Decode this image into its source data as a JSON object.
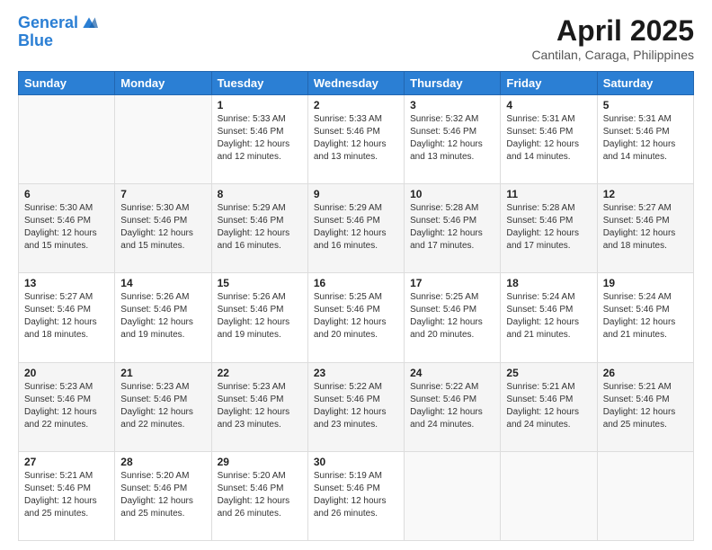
{
  "header": {
    "logo_line1": "General",
    "logo_line2": "Blue",
    "title": "April 2025",
    "subtitle": "Cantilan, Caraga, Philippines"
  },
  "days_of_week": [
    "Sunday",
    "Monday",
    "Tuesday",
    "Wednesday",
    "Thursday",
    "Friday",
    "Saturday"
  ],
  "weeks": [
    [
      {
        "day": "",
        "sunrise": "",
        "sunset": "",
        "daylight": ""
      },
      {
        "day": "",
        "sunrise": "",
        "sunset": "",
        "daylight": ""
      },
      {
        "day": "1",
        "sunrise": "Sunrise: 5:33 AM",
        "sunset": "Sunset: 5:46 PM",
        "daylight": "Daylight: 12 hours and 12 minutes."
      },
      {
        "day": "2",
        "sunrise": "Sunrise: 5:33 AM",
        "sunset": "Sunset: 5:46 PM",
        "daylight": "Daylight: 12 hours and 13 minutes."
      },
      {
        "day": "3",
        "sunrise": "Sunrise: 5:32 AM",
        "sunset": "Sunset: 5:46 PM",
        "daylight": "Daylight: 12 hours and 13 minutes."
      },
      {
        "day": "4",
        "sunrise": "Sunrise: 5:31 AM",
        "sunset": "Sunset: 5:46 PM",
        "daylight": "Daylight: 12 hours and 14 minutes."
      },
      {
        "day": "5",
        "sunrise": "Sunrise: 5:31 AM",
        "sunset": "Sunset: 5:46 PM",
        "daylight": "Daylight: 12 hours and 14 minutes."
      }
    ],
    [
      {
        "day": "6",
        "sunrise": "Sunrise: 5:30 AM",
        "sunset": "Sunset: 5:46 PM",
        "daylight": "Daylight: 12 hours and 15 minutes."
      },
      {
        "day": "7",
        "sunrise": "Sunrise: 5:30 AM",
        "sunset": "Sunset: 5:46 PM",
        "daylight": "Daylight: 12 hours and 15 minutes."
      },
      {
        "day": "8",
        "sunrise": "Sunrise: 5:29 AM",
        "sunset": "Sunset: 5:46 PM",
        "daylight": "Daylight: 12 hours and 16 minutes."
      },
      {
        "day": "9",
        "sunrise": "Sunrise: 5:29 AM",
        "sunset": "Sunset: 5:46 PM",
        "daylight": "Daylight: 12 hours and 16 minutes."
      },
      {
        "day": "10",
        "sunrise": "Sunrise: 5:28 AM",
        "sunset": "Sunset: 5:46 PM",
        "daylight": "Daylight: 12 hours and 17 minutes."
      },
      {
        "day": "11",
        "sunrise": "Sunrise: 5:28 AM",
        "sunset": "Sunset: 5:46 PM",
        "daylight": "Daylight: 12 hours and 17 minutes."
      },
      {
        "day": "12",
        "sunrise": "Sunrise: 5:27 AM",
        "sunset": "Sunset: 5:46 PM",
        "daylight": "Daylight: 12 hours and 18 minutes."
      }
    ],
    [
      {
        "day": "13",
        "sunrise": "Sunrise: 5:27 AM",
        "sunset": "Sunset: 5:46 PM",
        "daylight": "Daylight: 12 hours and 18 minutes."
      },
      {
        "day": "14",
        "sunrise": "Sunrise: 5:26 AM",
        "sunset": "Sunset: 5:46 PM",
        "daylight": "Daylight: 12 hours and 19 minutes."
      },
      {
        "day": "15",
        "sunrise": "Sunrise: 5:26 AM",
        "sunset": "Sunset: 5:46 PM",
        "daylight": "Daylight: 12 hours and 19 minutes."
      },
      {
        "day": "16",
        "sunrise": "Sunrise: 5:25 AM",
        "sunset": "Sunset: 5:46 PM",
        "daylight": "Daylight: 12 hours and 20 minutes."
      },
      {
        "day": "17",
        "sunrise": "Sunrise: 5:25 AM",
        "sunset": "Sunset: 5:46 PM",
        "daylight": "Daylight: 12 hours and 20 minutes."
      },
      {
        "day": "18",
        "sunrise": "Sunrise: 5:24 AM",
        "sunset": "Sunset: 5:46 PM",
        "daylight": "Daylight: 12 hours and 21 minutes."
      },
      {
        "day": "19",
        "sunrise": "Sunrise: 5:24 AM",
        "sunset": "Sunset: 5:46 PM",
        "daylight": "Daylight: 12 hours and 21 minutes."
      }
    ],
    [
      {
        "day": "20",
        "sunrise": "Sunrise: 5:23 AM",
        "sunset": "Sunset: 5:46 PM",
        "daylight": "Daylight: 12 hours and 22 minutes."
      },
      {
        "day": "21",
        "sunrise": "Sunrise: 5:23 AM",
        "sunset": "Sunset: 5:46 PM",
        "daylight": "Daylight: 12 hours and 22 minutes."
      },
      {
        "day": "22",
        "sunrise": "Sunrise: 5:23 AM",
        "sunset": "Sunset: 5:46 PM",
        "daylight": "Daylight: 12 hours and 23 minutes."
      },
      {
        "day": "23",
        "sunrise": "Sunrise: 5:22 AM",
        "sunset": "Sunset: 5:46 PM",
        "daylight": "Daylight: 12 hours and 23 minutes."
      },
      {
        "day": "24",
        "sunrise": "Sunrise: 5:22 AM",
        "sunset": "Sunset: 5:46 PM",
        "daylight": "Daylight: 12 hours and 24 minutes."
      },
      {
        "day": "25",
        "sunrise": "Sunrise: 5:21 AM",
        "sunset": "Sunset: 5:46 PM",
        "daylight": "Daylight: 12 hours and 24 minutes."
      },
      {
        "day": "26",
        "sunrise": "Sunrise: 5:21 AM",
        "sunset": "Sunset: 5:46 PM",
        "daylight": "Daylight: 12 hours and 25 minutes."
      }
    ],
    [
      {
        "day": "27",
        "sunrise": "Sunrise: 5:21 AM",
        "sunset": "Sunset: 5:46 PM",
        "daylight": "Daylight: 12 hours and 25 minutes."
      },
      {
        "day": "28",
        "sunrise": "Sunrise: 5:20 AM",
        "sunset": "Sunset: 5:46 PM",
        "daylight": "Daylight: 12 hours and 25 minutes."
      },
      {
        "day": "29",
        "sunrise": "Sunrise: 5:20 AM",
        "sunset": "Sunset: 5:46 PM",
        "daylight": "Daylight: 12 hours and 26 minutes."
      },
      {
        "day": "30",
        "sunrise": "Sunrise: 5:19 AM",
        "sunset": "Sunset: 5:46 PM",
        "daylight": "Daylight: 12 hours and 26 minutes."
      },
      {
        "day": "",
        "sunrise": "",
        "sunset": "",
        "daylight": ""
      },
      {
        "day": "",
        "sunrise": "",
        "sunset": "",
        "daylight": ""
      },
      {
        "day": "",
        "sunrise": "",
        "sunset": "",
        "daylight": ""
      }
    ]
  ]
}
